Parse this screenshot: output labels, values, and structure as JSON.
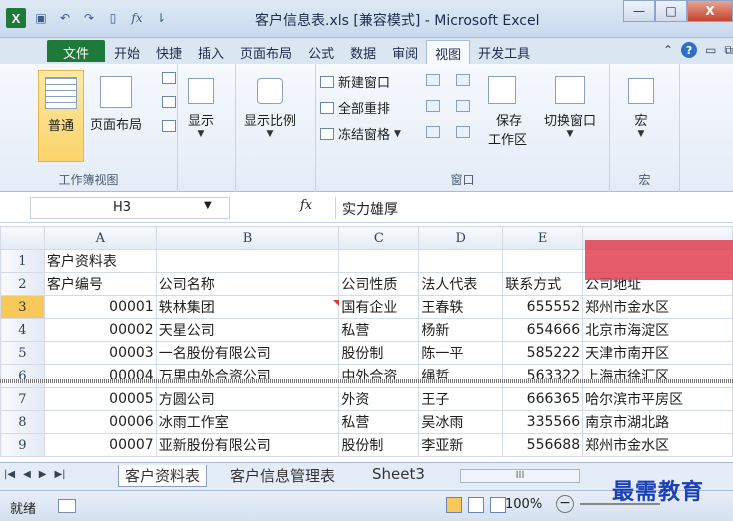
{
  "window": {
    "title": "客户信息表.xls [兼容模式] - Microsoft Excel",
    "app_icon": "X",
    "controls": {
      "minimize": "—",
      "maximize": "□",
      "close": "X"
    }
  },
  "qat": {
    "save_icon": "save-icon",
    "undo_icon": "undo-icon",
    "redo_icon": "redo-icon",
    "fx_label": "fx"
  },
  "tabs": [
    {
      "label": "文件"
    },
    {
      "label": "开始"
    },
    {
      "label": "快捷"
    },
    {
      "label": "插入"
    },
    {
      "label": "页面布局"
    },
    {
      "label": "公式"
    },
    {
      "label": "数据"
    },
    {
      "label": "审阅"
    },
    {
      "label": "视图"
    },
    {
      "label": "开发工具"
    }
  ],
  "ribbon": {
    "workbook_views": {
      "label": "工作簿视图",
      "normal": "普通",
      "page_layout": "页面布局"
    },
    "show": {
      "label": "显示"
    },
    "zoom": {
      "label": "显示比例"
    },
    "window": {
      "label": "窗口",
      "new_window": "新建窗口",
      "arrange_all": "全部重排",
      "freeze_panes": "冻结窗格",
      "save_workspace_1": "保存",
      "save_workspace_2": "工作区",
      "switch_windows": "切换窗口"
    },
    "macros": {
      "btn": "宏",
      "label": "宏"
    }
  },
  "formula_bar": {
    "cell_ref": "H3",
    "fx": "fx",
    "content": "实力雄厚"
  },
  "columns": [
    "A",
    "B",
    "C",
    "D",
    "E"
  ],
  "rows": [
    {
      "num": "1",
      "cells": [
        "客户资料表",
        "",
        "",
        "",
        "",
        ""
      ]
    },
    {
      "num": "2",
      "cells": [
        "客户编号",
        "公司名称",
        "公司性质",
        "法人代表",
        "联系方式",
        "公司地址"
      ]
    },
    {
      "num": "3",
      "cells": [
        "00001",
        "轶林集团",
        "国有企业",
        "王春轶",
        "655552",
        "郑州市金水区"
      ]
    },
    {
      "num": "4",
      "cells": [
        "00002",
        "天星公司",
        "私营",
        "杨新",
        "654666",
        "北京市海淀区"
      ]
    },
    {
      "num": "5",
      "cells": [
        "00003",
        "一名股份有限公司",
        "股份制",
        "陈一平",
        "585222",
        "天津市南开区"
      ]
    },
    {
      "num": "6",
      "cells": [
        "00004",
        "万里中外合资公司",
        "中外合资",
        "绳哲",
        "563322",
        "上海市徐汇区"
      ]
    },
    {
      "num": "7",
      "cells": [
        "00005",
        "方圆公司",
        "外资",
        "王子",
        "666365",
        "哈尔滨市平房区"
      ]
    },
    {
      "num": "8",
      "cells": [
        "00006",
        "冰雨工作室",
        "私营",
        "吴冰雨",
        "335566",
        "南京市湖北路"
      ]
    },
    {
      "num": "9",
      "cells": [
        "00007",
        "亚新股份有限公司",
        "股份制",
        "李亚新",
        "556688",
        "郑州市金水区"
      ]
    }
  ],
  "sheets": [
    {
      "label": "客户资料表"
    },
    {
      "label": "客户信息管理表"
    },
    {
      "label": "Sheet3"
    }
  ],
  "status": {
    "ready": "就绪",
    "zoom": "100%",
    "minus": "−"
  },
  "watermark": "最需教育"
}
